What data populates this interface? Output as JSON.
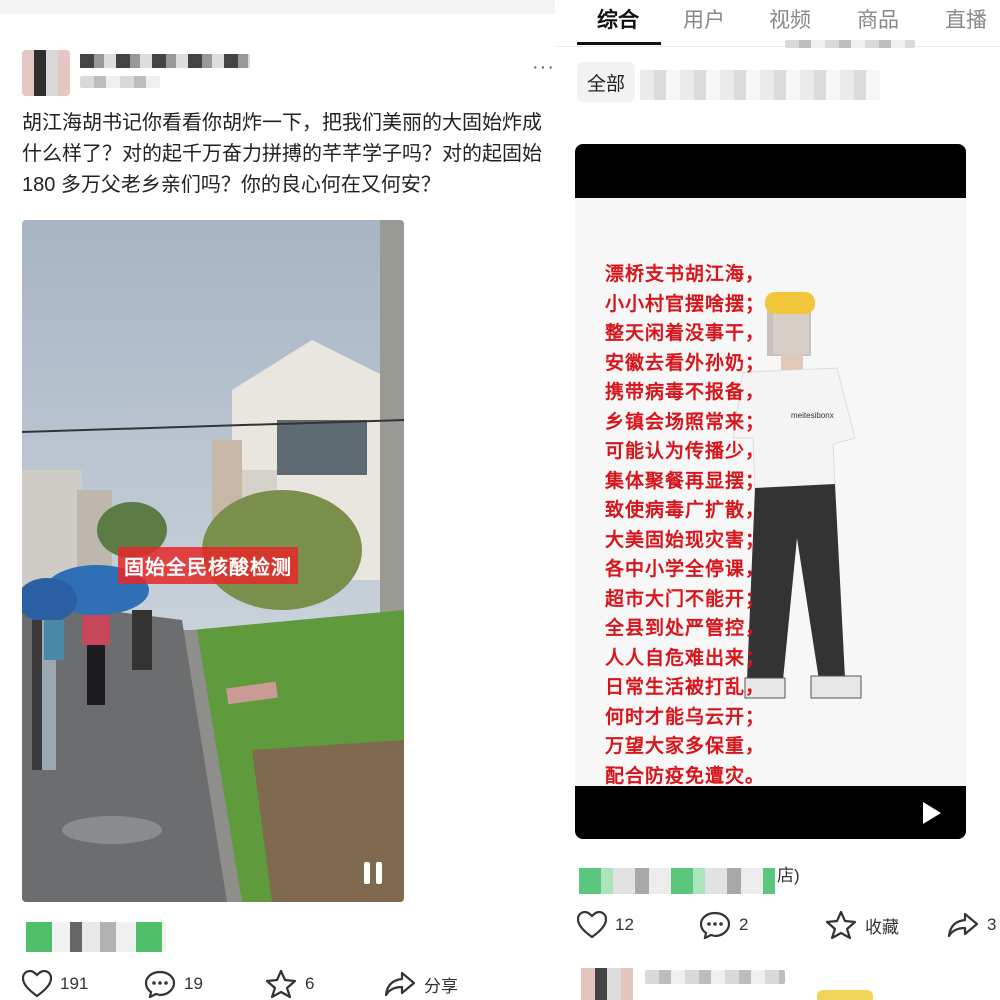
{
  "left_post": {
    "text": "胡江海胡书记你看看你胡炸一下，把我们美丽的大固始炸成什么样了？对的起千万奋力拼搏的芊芊学子吗？对的起固始 180 多万父老乡亲们吗？你的良心何在又何安？",
    "image_caption": "固始全民核酸检测",
    "actions": {
      "likes": "191",
      "comments": "19",
      "favorites": "6",
      "share_label": "分享"
    }
  },
  "right_panel": {
    "tabs": [
      "综合",
      "用户",
      "视频",
      "商品",
      "直播"
    ],
    "active_tab": "综合",
    "filter_label": "全部",
    "video_poem": [
      "漂桥支书胡江海，",
      "小小村官摆啥摆；",
      "整天闲着没事干，",
      "安徽去看外孙奶；",
      "携带病毒不报备，",
      "乡镇会场照常来；",
      "可能认为传播少，",
      "集体聚餐再显摆；",
      "致使病毒广扩散，",
      "大美固始现灾害；",
      "各中小学全停课，",
      "超市大门不能开；",
      "全县到处严管控，",
      "人人自危难出来；",
      "日常生活被打乱，",
      "何时才能乌云开；",
      "万望大家多保重，",
      "配合防疫免遭灾。"
    ],
    "shirt_text": "meitesibonx",
    "author_suffix": "店)",
    "actions": {
      "likes": "12",
      "comments": "2",
      "favorite_label": "收藏",
      "shares": "3"
    }
  },
  "icons": [
    "heart-icon",
    "comment-icon",
    "star-icon",
    "share-icon",
    "pause-icon",
    "play-icon",
    "more-icon"
  ]
}
